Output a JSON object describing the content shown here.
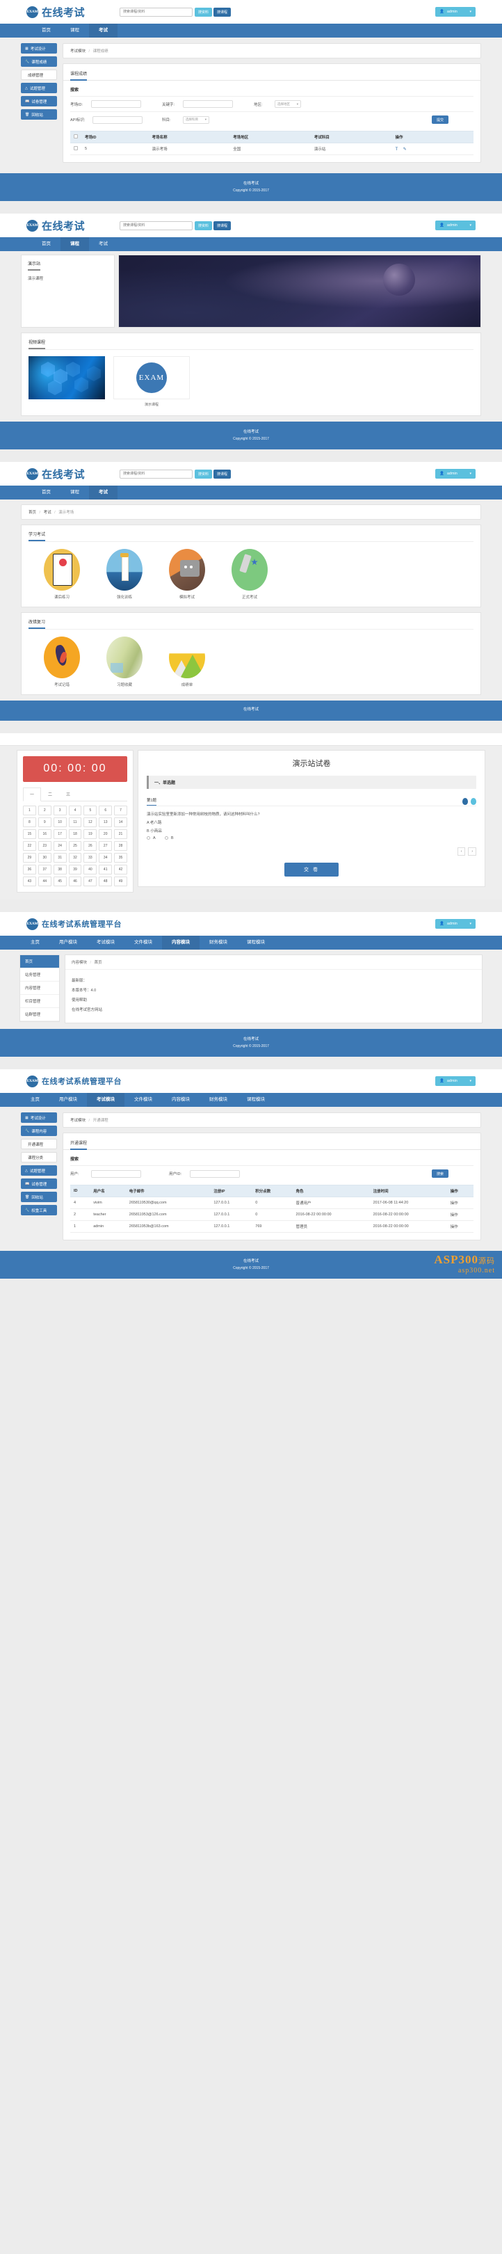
{
  "brand": {
    "logo_text": "EXAM",
    "title": "在线考试",
    "admin_title": "在线考试系统管理平台"
  },
  "header": {
    "search_placeholder": "搜索课程/资料",
    "btn_resource": "搜资料",
    "btn_course": "搜课程",
    "user": "admin",
    "caret": "▾",
    "user_icon": "user-icon"
  },
  "nav": {
    "items": [
      {
        "label": "首页"
      },
      {
        "label": "课程"
      },
      {
        "label": "考试"
      }
    ],
    "active_index": 2
  },
  "panel1": {
    "sidebar": [
      {
        "label": "考试设计",
        "icon": "grid-icon",
        "type": "btn"
      },
      {
        "label": "课程成绩",
        "icon": "wrench-icon",
        "type": "btn"
      },
      {
        "label": "成绩管理",
        "icon": "",
        "type": "sub"
      },
      {
        "label": "试题管理",
        "icon": "triangle-icon",
        "type": "btn"
      },
      {
        "label": "试卷管理",
        "icon": "book-icon",
        "type": "btn"
      },
      {
        "label": "回收站",
        "icon": "trash-icon",
        "type": "btn"
      }
    ],
    "breadcrumb": {
      "first": "考试模块",
      "sep": "/",
      "second": "课程成绩"
    },
    "tab_title": "课程成绩",
    "search_title": "搜索",
    "fields": {
      "exam_id_label": "考场ID:",
      "keyword_label": "关键字:",
      "region_label": "地区:",
      "region_value": "选择地区",
      "api_label": "API标识:",
      "subject_label": "科目:",
      "subject_value": "选择科目",
      "submit": "提交"
    },
    "table": {
      "headers": [
        "",
        "考场ID",
        "考场名称",
        "考场地区",
        "考试科目",
        "操作"
      ],
      "rows": [
        {
          "id": "5",
          "name": "演示考场",
          "region": "全国",
          "subject": "演示站",
          "ops": [
            "T",
            "edit"
          ]
        }
      ]
    }
  },
  "footer": {
    "line1": "在线考试",
    "line2": "Copyright © 2015-2017"
  },
  "panel2": {
    "left_title": "演示站",
    "left_sub": "演示课程",
    "video_title": "视频课程",
    "video_items": [
      {
        "caption": "",
        "kind": "hex-image"
      },
      {
        "caption": "演示课程",
        "kind": "exam-logo",
        "logo_text": "EXAM"
      }
    ]
  },
  "panel3": {
    "breadcrumb": [
      "首页",
      "考试",
      "演示考场"
    ],
    "section1_title": "学习考试",
    "section1_items": [
      {
        "label": "课后练习",
        "ill": "ill-a"
      },
      {
        "label": "强化训练",
        "ill": "ill-b"
      },
      {
        "label": "模拟考试",
        "ill": "ill-c"
      },
      {
        "label": "正式考试",
        "ill": "ill-d"
      }
    ],
    "section2_title": "改错复习",
    "section2_items": [
      {
        "label": "考试记错",
        "ill": "ill-e"
      },
      {
        "label": "习题收藏",
        "ill": "ill-f"
      },
      {
        "label": "成绩单",
        "ill": "ill-g"
      }
    ]
  },
  "panel4": {
    "topbar": "在线考试",
    "timer": "00: 00: 00",
    "qtabs": [
      "一",
      "二",
      "三"
    ],
    "qnums": [
      "1",
      "2",
      "3",
      "4",
      "5",
      "6",
      "7",
      "8",
      "9",
      "10",
      "11",
      "12",
      "13",
      "14",
      "15",
      "16",
      "17",
      "18",
      "19",
      "20",
      "21",
      "22",
      "23",
      "24",
      "25",
      "26",
      "27",
      "28",
      "29",
      "30",
      "31",
      "32",
      "33",
      "34",
      "35",
      "36",
      "37",
      "38",
      "39",
      "40",
      "41",
      "42",
      "43",
      "44",
      "45",
      "46",
      "47",
      "48",
      "49"
    ],
    "paper_title": "演示站试卷",
    "section_label": "一、单选题",
    "question_no": "第1题",
    "question_text": "演示站实验室里新添加一种常用树枝的物质，请问这种材料叫什么?",
    "options": [
      "A 老八路",
      "B 小商品"
    ],
    "answer_choices": [
      "A",
      "B"
    ],
    "nav_prev": "‹",
    "nav_next": "›",
    "submit": "交 卷"
  },
  "panel5": {
    "nav": [
      "主页",
      "用户模块",
      "考试模块",
      "文件模块",
      "内容模块",
      "财务模块",
      "课程模块"
    ],
    "side": [
      {
        "label": "首页",
        "active": true
      },
      {
        "label": "站务管理",
        "active": false
      },
      {
        "label": "内容管理",
        "active": false
      },
      {
        "label": "栏目管理",
        "active": false
      },
      {
        "label": "站群管理",
        "active": false
      }
    ],
    "breadcrumb": {
      "first": "内容模块",
      "sep": "/",
      "second": "首页"
    },
    "info": [
      "最新版：",
      "本版本号：4.0",
      "使用帮助",
      "在线考试官方网站"
    ]
  },
  "panel6": {
    "nav": [
      "主页",
      "用户模块",
      "考试模块",
      "文件模块",
      "内容模块",
      "财务模块",
      "课程模块"
    ],
    "sidebar": [
      {
        "label": "考试设计",
        "icon": "grid-icon",
        "type": "btn"
      },
      {
        "label": "课程内容",
        "icon": "wrench-icon",
        "type": "btn"
      },
      {
        "label": "开通课程",
        "icon": "",
        "type": "sub"
      },
      {
        "label": "课程分类",
        "icon": "",
        "type": "sub"
      },
      {
        "label": "试题管理",
        "icon": "triangle-icon",
        "type": "btn"
      },
      {
        "label": "试卷管理",
        "icon": "book-icon",
        "type": "btn"
      },
      {
        "label": "回收站",
        "icon": "trash-icon",
        "type": "btn"
      },
      {
        "label": "权重工具",
        "icon": "wrench-icon",
        "type": "btn"
      }
    ],
    "breadcrumb": {
      "first": "考试模块",
      "sep": "/",
      "second": "开通课程"
    },
    "tab_title": "开通课程",
    "search_title": "搜索",
    "fields": {
      "user_label": "用户:",
      "user_id_label": "用户ID:",
      "submit": "搜索"
    },
    "table": {
      "headers": [
        "ID",
        "用户名",
        "电子邮件",
        "注册IP",
        "积分点数",
        "角色",
        "注册时间",
        "操作"
      ],
      "rows": [
        {
          "id": "4",
          "user": "vivim",
          "email": "2658119530@qq.com",
          "ip": "127.0.0.1",
          "points": "0",
          "role": "普通用户",
          "time": "2017-06-08 11:44:20",
          "op": "操作"
        },
        {
          "id": "2",
          "user": "teacher",
          "email": "265811953@126.com",
          "ip": "127.0.0.1",
          "points": "0",
          "role": "2016-08-22 00:00:00",
          "time": "2016-08-22 00:00:00",
          "op": "操作"
        },
        {
          "id": "1",
          "user": "admin",
          "email": "265811953b@163.com",
          "ip": "127.0.0.1",
          "points": "769",
          "role": "管理员",
          "time": "2016-08-22 00:00:00",
          "op": "操作"
        }
      ]
    }
  },
  "watermark": {
    "big": "ASP300",
    "cn": "源码",
    "sub": "asp300.net"
  }
}
